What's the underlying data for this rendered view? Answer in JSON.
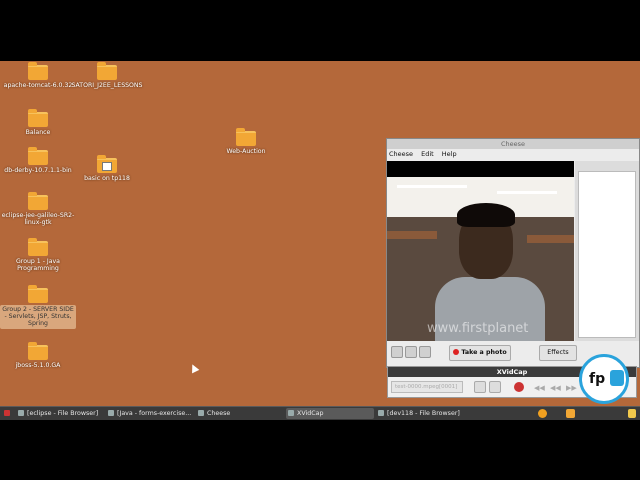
{
  "desktop": {
    "icons": [
      {
        "label": "apache-tomcat-6.0.32",
        "type": "folder"
      },
      {
        "label": "SATORI_J2EE_LESSONS",
        "type": "folder"
      },
      {
        "label": "Balance",
        "type": "folder"
      },
      {
        "label": "db-derby-10.7.1.1-bin",
        "type": "folder"
      },
      {
        "label": "eclipse-jee-galileo-SR2-linux-gtk",
        "type": "folder"
      },
      {
        "label": "Group 1 - Java Programming",
        "type": "folder"
      },
      {
        "label": "Group 2 - SERVER SIDE - Servlets, JSP, Struts, Spring",
        "type": "folder"
      },
      {
        "label": "jboss-5.1.0.GA",
        "type": "folder"
      },
      {
        "label": "basic on tp118",
        "type": "document"
      },
      {
        "label": "Web-Auction",
        "type": "folder"
      }
    ]
  },
  "cheese": {
    "title": "Cheese",
    "menu": [
      "Cheese",
      "Edit",
      "Help"
    ],
    "watermark": "www.firstplanet",
    "take_photo": "Take a photo",
    "effects": "Effects"
  },
  "xvidcap": {
    "title": "XVidCap",
    "file": "test-0000.mpeg[0001]"
  },
  "taskbar": {
    "items": [
      {
        "label": "[eclipse - File Browser]",
        "active": false
      },
      {
        "label": "[Java - forms-exercise...",
        "active": false
      },
      {
        "label": "Cheese",
        "active": false
      },
      {
        "label": "XVidCap",
        "active": true
      },
      {
        "label": "[dev118 - File Browser]",
        "active": false
      }
    ]
  },
  "logo": {
    "text": "fp",
    "icon": "tv-icon"
  },
  "colors": {
    "desktop": "#b4683a",
    "folder": "#f2a735",
    "accent": "#2aa3dc"
  }
}
